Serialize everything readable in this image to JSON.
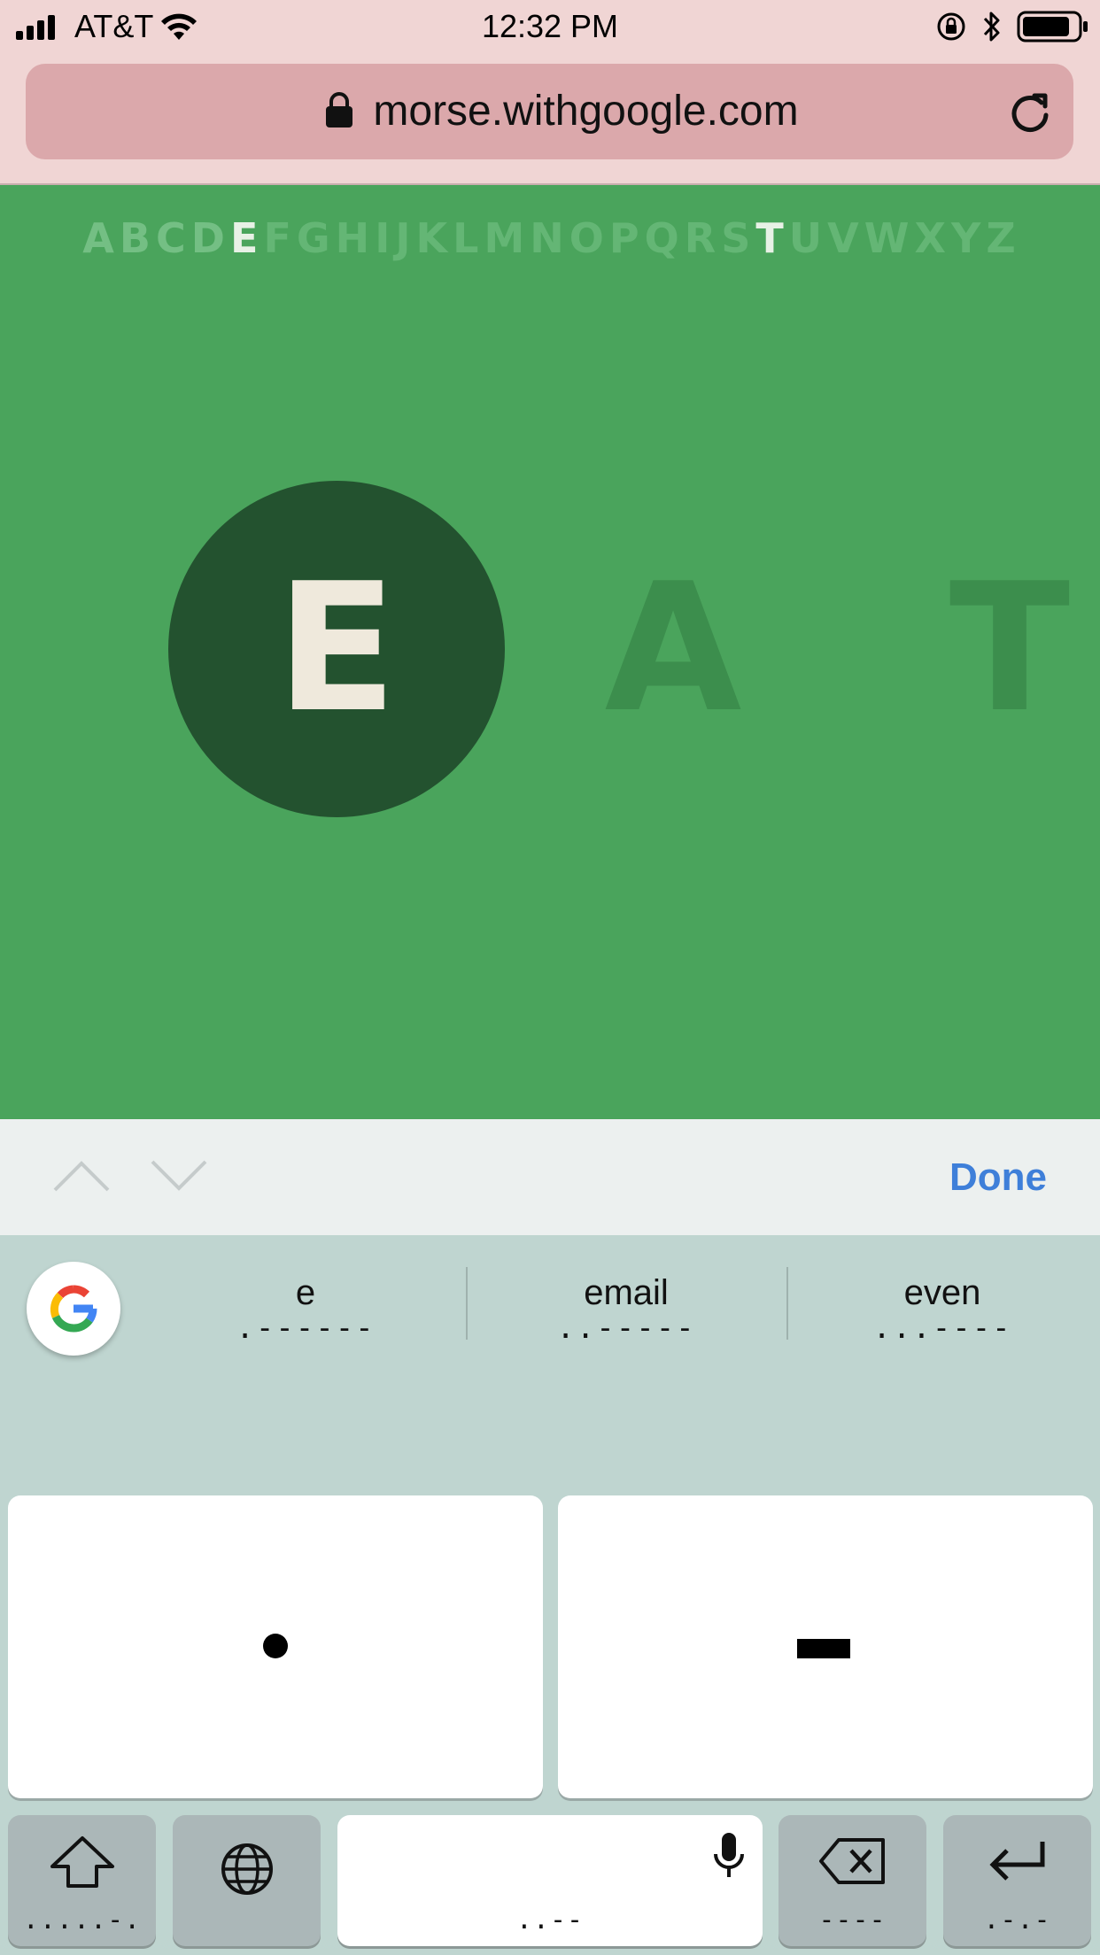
{
  "status_bar": {
    "carrier": "AT&T",
    "time": "12:32 PM"
  },
  "browser": {
    "url": "morse.withgoogle.com"
  },
  "game": {
    "alphabet": [
      "A",
      "B",
      "C",
      "D",
      "E",
      "F",
      "G",
      "H",
      "I",
      "J",
      "K",
      "L",
      "M",
      "N",
      "O",
      "P",
      "Q",
      "R",
      "S",
      "T",
      "U",
      "V",
      "W",
      "X",
      "Y",
      "Z"
    ],
    "highlighted_letters": [
      "E",
      "T"
    ],
    "current_letter": "E",
    "upcoming_letters": [
      "A",
      "T"
    ]
  },
  "accessory_bar": {
    "done_label": "Done"
  },
  "suggestions": [
    {
      "word": "e",
      "code": ".------"
    },
    {
      "word": "email",
      "code": "..-----"
    },
    {
      "word": "even",
      "code": "...----"
    }
  ],
  "keyboard": {
    "dot_key": "dot",
    "dash_key": "dash",
    "bottom_row": [
      {
        "name": "shift",
        "icon": "shift-icon",
        "code": ".....-."
      },
      {
        "name": "globe",
        "icon": "globe-icon",
        "code": ""
      },
      {
        "name": "space",
        "icon": "microphone-icon",
        "code": "..--"
      },
      {
        "name": "backspace",
        "icon": "backspace-icon",
        "code": "----"
      },
      {
        "name": "return",
        "icon": "return-icon",
        "code": ".-.-"
      }
    ]
  },
  "colors": {
    "game_bg": "#4aa45c",
    "bubble": "#23522f",
    "done": "#3e7fd9",
    "url_bar": "#dba8ab"
  }
}
